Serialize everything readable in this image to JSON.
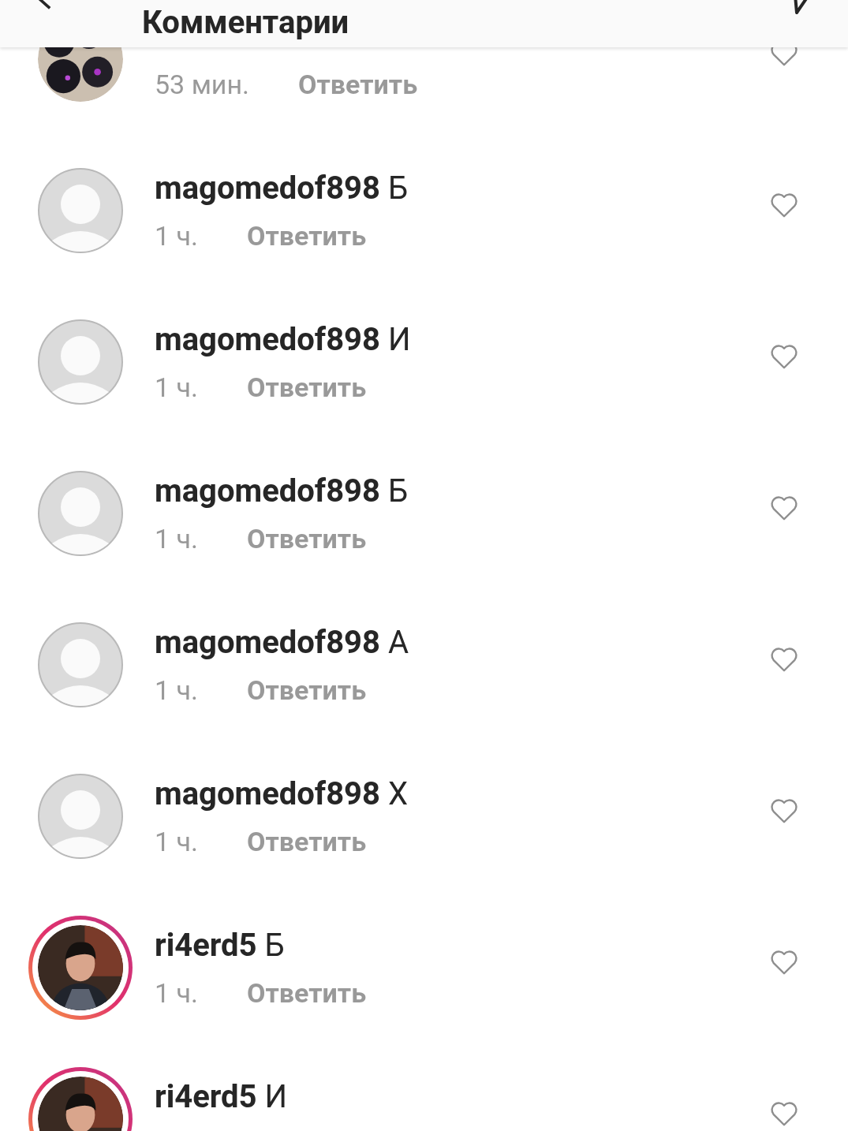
{
  "header": {
    "title": "Комментарии"
  },
  "comments": [
    {
      "avatar": {
        "kind": "picture",
        "story_ring": false
      },
      "time": "53 мин.",
      "reply": "Ответить",
      "liked": false
    },
    {
      "avatar": {
        "kind": "default",
        "story_ring": false
      },
      "user": "magomedof898",
      "text": "Б",
      "time": "1 ч.",
      "reply": "Ответить",
      "liked": false
    },
    {
      "avatar": {
        "kind": "default",
        "story_ring": false
      },
      "user": "magomedof898",
      "text": "И",
      "time": "1 ч.",
      "reply": "Ответить",
      "liked": false
    },
    {
      "avatar": {
        "kind": "default",
        "story_ring": false
      },
      "user": "magomedof898",
      "text": "Б",
      "time": "1 ч.",
      "reply": "Ответить",
      "liked": false
    },
    {
      "avatar": {
        "kind": "default",
        "story_ring": false
      },
      "user": "magomedof898",
      "text": "А",
      "time": "1 ч.",
      "reply": "Ответить",
      "liked": false
    },
    {
      "avatar": {
        "kind": "default",
        "story_ring": false
      },
      "user": "magomedof898",
      "text": "Х",
      "time": "1 ч.",
      "reply": "Ответить",
      "liked": false
    },
    {
      "avatar": {
        "kind": "picture",
        "story_ring": true
      },
      "user": "ri4erd5",
      "text": "Б",
      "time": "1 ч.",
      "reply": "Ответить",
      "liked": false
    },
    {
      "avatar": {
        "kind": "picture",
        "story_ring": true
      },
      "user": "ri4erd5",
      "text": "И",
      "liked": false
    }
  ]
}
